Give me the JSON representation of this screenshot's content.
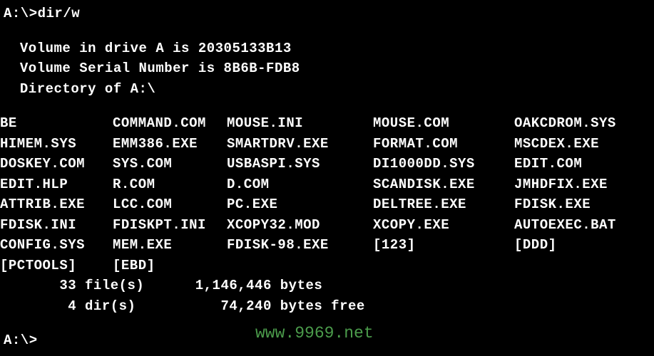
{
  "prompt": "A:\\>dir/w",
  "volume_line": " Volume in drive A is 20305133B13",
  "serial_line": " Volume Serial Number is 8B6B-FDB8",
  "directory_line": " Directory of A:\\",
  "files": [
    [
      "BE",
      "COMMAND.COM",
      "MOUSE.INI",
      "MOUSE.COM",
      "OAKCDROM.SYS"
    ],
    [
      "HIMEM.SYS",
      "EMM386.EXE",
      "SMARTDRV.EXE",
      "FORMAT.COM",
      "MSCDEX.EXE"
    ],
    [
      "DOSKEY.COM",
      "SYS.COM",
      "USBASPI.SYS",
      "DI1000DD.SYS",
      "EDIT.COM"
    ],
    [
      "EDIT.HLP",
      "R.COM",
      "D.COM",
      "SCANDISK.EXE",
      "JMHDFIX.EXE"
    ],
    [
      "ATTRIB.EXE",
      "LCC.COM",
      "PC.EXE",
      "DELTREE.EXE",
      "FDISK.EXE"
    ],
    [
      "FDISK.INI",
      "FDISKPT.INI",
      "XCOPY32.MOD",
      "XCOPY.EXE",
      "AUTOEXEC.BAT"
    ],
    [
      "CONFIG.SYS",
      "MEM.EXE",
      "FDISK-98.EXE",
      "[123]",
      "[DDD]"
    ],
    [
      "[PCTOOLS]",
      "[EBD]",
      "",
      "",
      ""
    ]
  ],
  "summary_files": "       33 file(s)      1,146,446 bytes",
  "summary_dirs": "        4 dir(s)          74,240 bytes free",
  "bottom_prompt": "A:\\>",
  "watermark": "www.9969.net"
}
